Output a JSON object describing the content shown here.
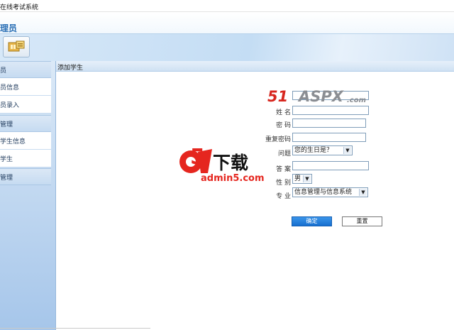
{
  "window": {
    "title": "在线考试系统"
  },
  "banner": {
    "role": "理员"
  },
  "sidebar": {
    "items": [
      {
        "label": "员",
        "type": "header"
      },
      {
        "label": "员信息",
        "type": "item"
      },
      {
        "label": "员录入",
        "type": "item"
      },
      {
        "label": "管理",
        "type": "header"
      },
      {
        "label": "学生信息",
        "type": "item"
      },
      {
        "label": "学生",
        "type": "item"
      },
      {
        "label": "管理",
        "type": "header"
      }
    ]
  },
  "content": {
    "title": "添加学生"
  },
  "form": {
    "name_label": "姓 名",
    "password_label": "密 码",
    "confirm_label": "重复密码",
    "question_label": "问题",
    "question_value": "您的生日是？",
    "answer_label": "答 案",
    "gender_label": "性 别",
    "gender_value": "男",
    "major_label": "专 业",
    "major_value": "信息管理与信息系统",
    "submit_label": "确定",
    "reset_label": "重置"
  },
  "watermarks": {
    "aspx_num": "51",
    "aspx_text": "ASPX",
    "aspx_domain": ".com",
    "a5_letter": "a",
    "a5_num": "5",
    "a5_cn": "下载",
    "a5_domain": "admin5.com"
  },
  "colors": {
    "accent": "#1c7ad9",
    "sidebar": "#c6dbf1",
    "watermark_red": "#e5261f"
  }
}
